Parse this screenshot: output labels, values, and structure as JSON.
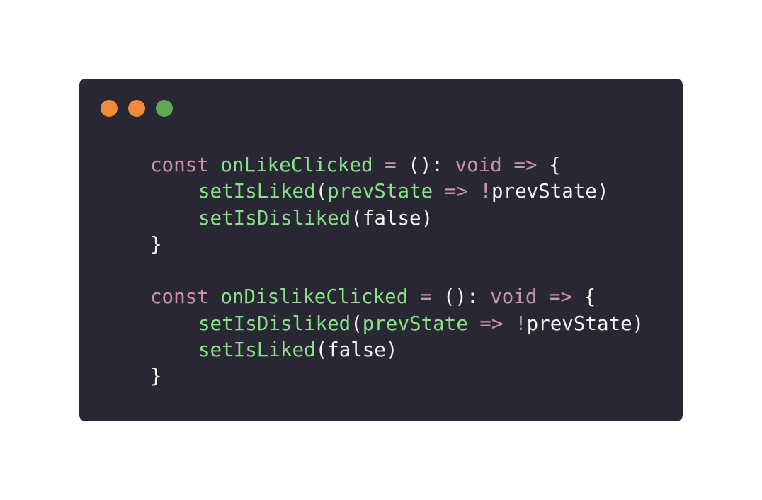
{
  "colors": {
    "window_bg": "#282733",
    "keyword": "#c792b4",
    "function": "#89e289",
    "plain": "#f3f3f1",
    "dot_close": "#f38c3a",
    "dot_minimize": "#f38c3a",
    "dot_maximize": "#5faa58"
  },
  "window_controls": [
    {
      "name": "close-dot",
      "color": "#f38c3a"
    },
    {
      "name": "minimize-dot",
      "color": "#f38c3a"
    },
    {
      "name": "maximize-dot",
      "color": "#5faa58"
    }
  ],
  "code": {
    "lines": [
      {
        "indent": false,
        "tokens": [
          {
            "t": "kw",
            "text": "const"
          },
          {
            "t": "plain",
            "text": " "
          },
          {
            "t": "fn",
            "text": "onLikeClicked"
          },
          {
            "t": "plain",
            "text": " "
          },
          {
            "t": "kw",
            "text": "="
          },
          {
            "t": "plain",
            "text": " (): "
          },
          {
            "t": "kw",
            "text": "void"
          },
          {
            "t": "plain",
            "text": " "
          },
          {
            "t": "kw",
            "text": "=>"
          },
          {
            "t": "plain",
            "text": " {"
          }
        ]
      },
      {
        "indent": true,
        "tokens": [
          {
            "t": "fn",
            "text": "setIsLiked"
          },
          {
            "t": "plain",
            "text": "("
          },
          {
            "t": "fn",
            "text": "prevState"
          },
          {
            "t": "plain",
            "text": " "
          },
          {
            "t": "kw",
            "text": "=>"
          },
          {
            "t": "plain",
            "text": " "
          },
          {
            "t": "kw",
            "text": "!"
          },
          {
            "t": "plain",
            "text": "prevState)"
          }
        ]
      },
      {
        "indent": true,
        "tokens": [
          {
            "t": "fn",
            "text": "setIsDisliked"
          },
          {
            "t": "plain",
            "text": "(false)"
          }
        ]
      },
      {
        "indent": false,
        "tokens": [
          {
            "t": "plain",
            "text": "}"
          }
        ]
      },
      {
        "indent": false,
        "tokens": []
      },
      {
        "indent": false,
        "tokens": [
          {
            "t": "kw",
            "text": "const"
          },
          {
            "t": "plain",
            "text": " "
          },
          {
            "t": "fn",
            "text": "onDislikeClicked"
          },
          {
            "t": "plain",
            "text": " "
          },
          {
            "t": "kw",
            "text": "="
          },
          {
            "t": "plain",
            "text": " (): "
          },
          {
            "t": "kw",
            "text": "void"
          },
          {
            "t": "plain",
            "text": " "
          },
          {
            "t": "kw",
            "text": "=>"
          },
          {
            "t": "plain",
            "text": " {"
          }
        ]
      },
      {
        "indent": true,
        "tokens": [
          {
            "t": "fn",
            "text": "setIsDisliked"
          },
          {
            "t": "plain",
            "text": "("
          },
          {
            "t": "fn",
            "text": "prevState"
          },
          {
            "t": "plain",
            "text": " "
          },
          {
            "t": "kw",
            "text": "=>"
          },
          {
            "t": "plain",
            "text": " "
          },
          {
            "t": "kw",
            "text": "!"
          },
          {
            "t": "plain",
            "text": "prevState)"
          }
        ]
      },
      {
        "indent": true,
        "tokens": [
          {
            "t": "fn",
            "text": "setIsLiked"
          },
          {
            "t": "plain",
            "text": "(false)"
          }
        ]
      },
      {
        "indent": false,
        "tokens": [
          {
            "t": "plain",
            "text": "}"
          }
        ]
      }
    ]
  }
}
